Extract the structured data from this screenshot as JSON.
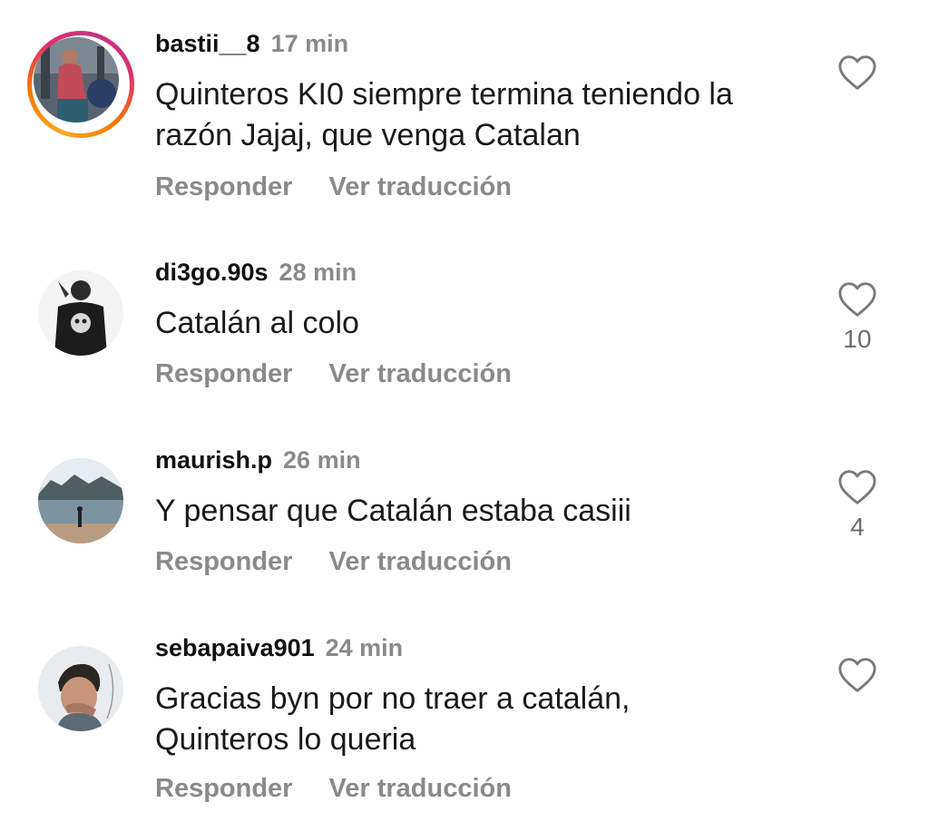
{
  "comments": [
    {
      "username": "bastii__8",
      "time": "17 min",
      "text_lines": [
        "Quinteros KI0 siempre termina teniendo la",
        "razón Jajaj, que venga Catalan"
      ],
      "reply_label": "Responder",
      "translate_label": "Ver traducción",
      "likes": "",
      "has_story": true
    },
    {
      "username": "di3go.90s",
      "time": "28 min",
      "text_lines": [
        "Catalán al colo"
      ],
      "reply_label": "Responder",
      "translate_label": "Ver traducción",
      "likes": "10",
      "has_story": false
    },
    {
      "username": "maurish.p",
      "time": "26 min",
      "text_lines": [
        "Y pensar que Catalán estaba casiii"
      ],
      "reply_label": "Responder",
      "translate_label": "Ver traducción",
      "likes": "4",
      "has_story": false
    },
    {
      "username": "sebapaiva901",
      "time": "24 min",
      "text_lines": [
        "Gracias byn por no traer a catalán,",
        "Quinteros lo queria"
      ],
      "reply_label": "Responder",
      "translate_label": "Ver traducción",
      "likes": "",
      "has_story": false
    }
  ],
  "icons": {
    "like": "heart-outline-icon"
  },
  "colors": {
    "muted_text": "#8a8a8a",
    "story_ring_start": "#f9a825",
    "story_ring_end": "#c13584"
  }
}
